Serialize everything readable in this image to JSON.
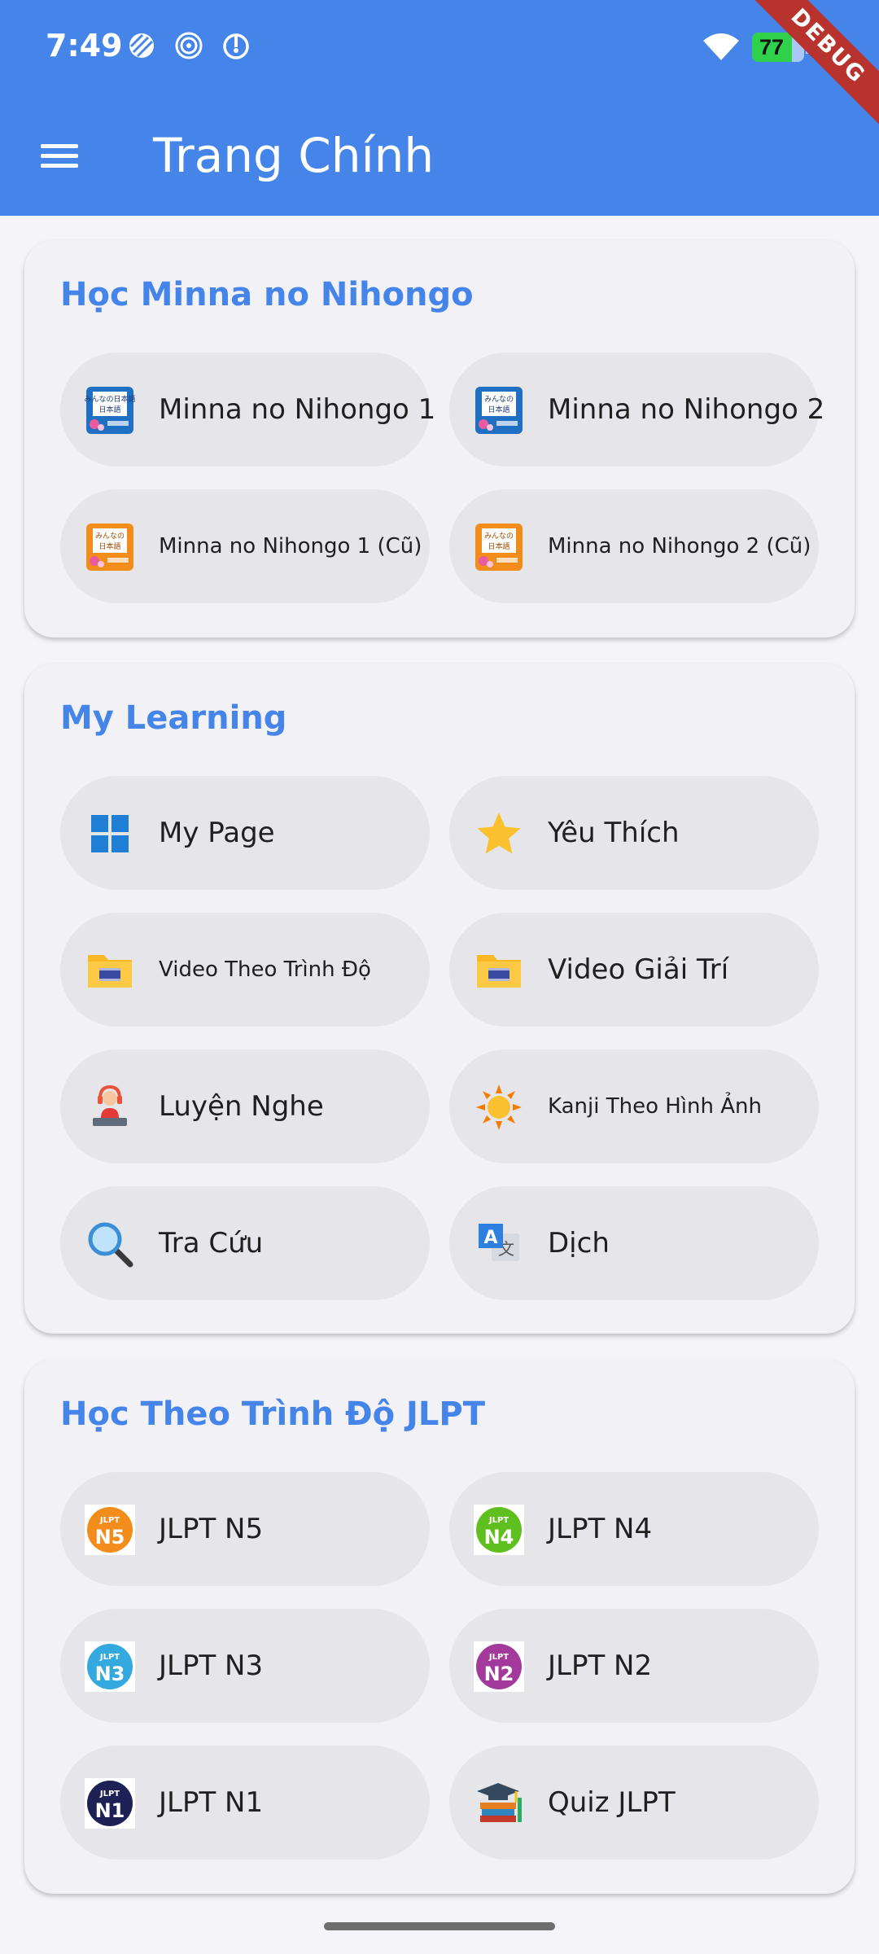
{
  "status_bar": {
    "time": "7:49",
    "battery_level": "77",
    "battery_fraction": 0.77
  },
  "debug_banner": "DEBUG",
  "app_bar": {
    "title": "Trang Chính"
  },
  "sections": {
    "minna": {
      "title": "Học Minna no Nihongo",
      "items": [
        {
          "label": "Minna no Nihongo 1",
          "icon": "minna-book-blue-icon"
        },
        {
          "label": "Minna no Nihongo 2",
          "icon": "minna-book-blue-icon"
        },
        {
          "label": "Minna no Nihongo 1 (Cũ)",
          "icon": "minna-book-orange-icon"
        },
        {
          "label": "Minna no Nihongo 2 (Cũ)",
          "icon": "minna-book-orange-icon"
        }
      ],
      "book_text": "みんなの日本語"
    },
    "learning": {
      "title": "My Learning",
      "items": [
        {
          "label": "My Page",
          "icon": "windows-grid-icon"
        },
        {
          "label": "Yêu Thích",
          "icon": "star-icon"
        },
        {
          "label": "Video Theo Trình Độ",
          "icon": "video-folder-icon"
        },
        {
          "label": "Video Giải Trí",
          "icon": "video-folder-icon"
        },
        {
          "label": "Luyện Nghe",
          "icon": "headphones-listener-icon"
        },
        {
          "label": "Kanji Theo Hình Ảnh",
          "icon": "sun-icon"
        },
        {
          "label": "Tra Cứu",
          "icon": "magnifier-icon"
        },
        {
          "label": "Dịch",
          "icon": "translate-icon"
        }
      ],
      "translate_glyph": "A",
      "translate_glyph2": "文"
    },
    "jlpt": {
      "title": "Học Theo Trình Độ JLPT",
      "items": [
        {
          "label": "JLPT N5",
          "icon": "jlpt-n5-badge-icon",
          "badge": "N5",
          "color": "#f28c1b"
        },
        {
          "label": "JLPT N4",
          "icon": "jlpt-n4-badge-icon",
          "badge": "N4",
          "color": "#5fbf1f"
        },
        {
          "label": "JLPT N3",
          "icon": "jlpt-n3-badge-icon",
          "badge": "N3",
          "color": "#34a9e0"
        },
        {
          "label": "JLPT N2",
          "icon": "jlpt-n2-badge-icon",
          "badge": "N2",
          "color": "#a33a9b"
        },
        {
          "label": "JLPT N1",
          "icon": "jlpt-n1-badge-icon",
          "badge": "N1",
          "color": "#1e2156"
        },
        {
          "label": "Quiz JLPT",
          "icon": "graduation-books-icon"
        }
      ],
      "badge_top_text": "JLPT"
    }
  },
  "colors": {
    "primary": "#4584e8",
    "card_bg": "#f1f1f6",
    "button_bg": "#e6e5ea",
    "debug": "#b8322e"
  }
}
